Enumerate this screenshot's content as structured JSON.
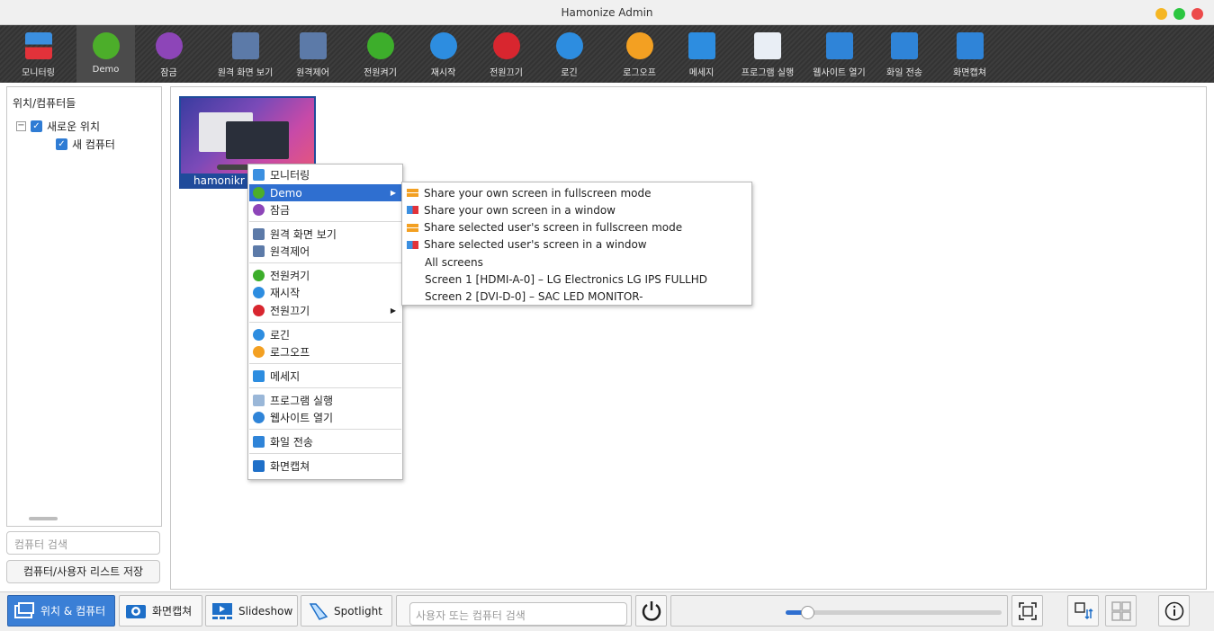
{
  "window": {
    "title": "Hamonize Admin",
    "buttons": {
      "yellow": "#f5b623",
      "green": "#2bc640",
      "red": "#ec4a4a"
    }
  },
  "toolbar": [
    {
      "name": "monitoring",
      "label": "모니터링",
      "color": "#3b8fe0"
    },
    {
      "name": "demo",
      "label": "Demo",
      "color": "#4cae2a"
    },
    {
      "name": "lock",
      "label": "잠금",
      "color": "#8d45b8"
    },
    {
      "name": "remote-view",
      "label": "원격 화면 보기",
      "color": "#5c7aa8"
    },
    {
      "name": "remote-control",
      "label": "원격제어",
      "color": "#5c7aa8"
    },
    {
      "name": "power-on",
      "label": "전원켜기",
      "color": "#3dae2b"
    },
    {
      "name": "reboot",
      "label": "재시작",
      "color": "#2d8de0"
    },
    {
      "name": "power-off",
      "label": "전원끄기",
      "color": "#d8262f"
    },
    {
      "name": "login",
      "label": "로긴",
      "color": "#2d8de0"
    },
    {
      "name": "logoff",
      "label": "로그오프",
      "color": "#f3a022"
    },
    {
      "name": "message",
      "label": "메세지",
      "color": "#2d8de0"
    },
    {
      "name": "run-program",
      "label": "프로그램 실행",
      "color": "#e9eef5"
    },
    {
      "name": "open-website",
      "label": "웹사이트 열기",
      "color": "#2f84d8"
    },
    {
      "name": "file-transfer",
      "label": "화일 전송",
      "color": "#2f84d8"
    },
    {
      "name": "screenshot",
      "label": "화면캡쳐",
      "color": "#2f84d8"
    }
  ],
  "tree": {
    "header": "위치/컴퓨터들",
    "location": "새로운 위치",
    "computer": "새 컴퓨터",
    "search_placeholder": "컴퓨터 검색",
    "save_label": "컴퓨터/사용자 리스트 저장"
  },
  "tile": {
    "label": "hamonikr"
  },
  "context_menu": [
    {
      "label": "모니터링",
      "icon": "monitoring-icon"
    },
    {
      "label": "Demo",
      "icon": "demo-icon",
      "selected": true,
      "submenu": true
    },
    {
      "label": "잠금",
      "icon": "lock-icon"
    },
    {
      "label": "원격 화면 보기",
      "icon": "remote-view-icon"
    },
    {
      "label": "원격제어",
      "icon": "remote-control-icon"
    },
    {
      "label": "전원켜기",
      "icon": "power-on-icon"
    },
    {
      "label": "재시작",
      "icon": "reboot-icon"
    },
    {
      "label": "전원끄기",
      "icon": "power-off-icon",
      "submenu": true
    },
    {
      "label": "로긴",
      "icon": "login-icon"
    },
    {
      "label": "로그오프",
      "icon": "logoff-icon"
    },
    {
      "label": "메세지",
      "icon": "message-icon"
    },
    {
      "label": "프로그램 실행",
      "icon": "run-program-icon"
    },
    {
      "label": "웹사이트 열기",
      "icon": "website-icon"
    },
    {
      "label": "화일 전송",
      "icon": "file-transfer-icon"
    },
    {
      "label": "화면캡쳐",
      "icon": "screenshot-icon"
    }
  ],
  "submenu": [
    "Share your own screen in fullscreen mode",
    "Share your own screen in a window",
    "Share selected user's screen in fullscreen mode",
    "Share selected user's screen in a window",
    "All screens",
    "Screen 1 [HDMI-A-0] – LG Electronics LG IPS FULLHD",
    "Screen 2 [DVI-D-0] – SAC LED MONITOR-"
  ],
  "bottom": {
    "locations_button": "위치 & 컴퓨터",
    "screenshot_button": "화면캡쳐",
    "slideshow_button": "Slideshow",
    "spotlight_button": "Spotlight",
    "search_placeholder": "사용자 또는 컴퓨터 검색",
    "zoom_level": 0.1
  }
}
